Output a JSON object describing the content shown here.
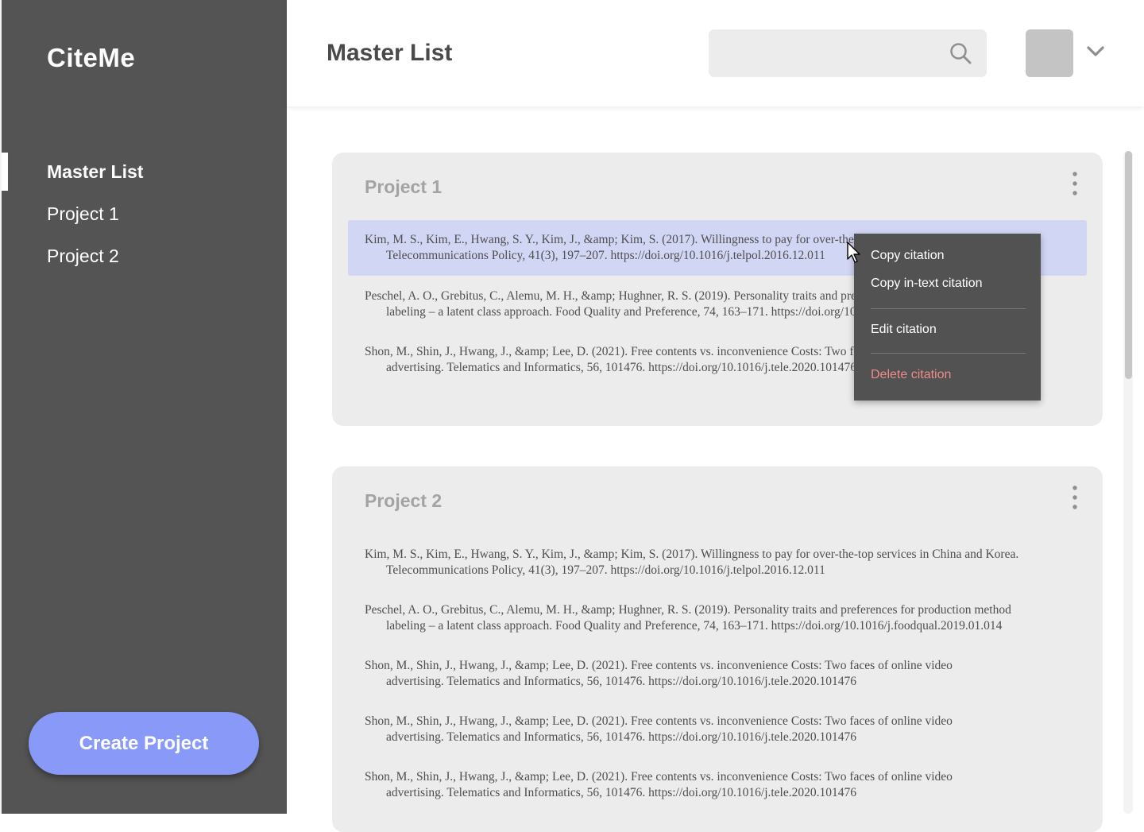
{
  "app": {
    "name": "CiteMe"
  },
  "sidebar": {
    "items": [
      {
        "label": "Master List",
        "active": true
      },
      {
        "label": "Project 1",
        "active": false
      },
      {
        "label": "Project 2",
        "active": false
      }
    ],
    "create_button": "Create Project"
  },
  "header": {
    "title": "Master List",
    "search": {
      "placeholder": "",
      "icon": "search-icon"
    },
    "avatar_icon": "avatar",
    "menu_icon": "chevron-down-icon"
  },
  "projects": [
    {
      "title": "Project 1",
      "citations": [
        {
          "line1": "Kim, M. S., Kim, E., Hwang, S. Y., Kim, J., &amp; Kim, S. (2017). Willingness to pay for over-the-top services in China and Korea.",
          "line2": "Telecommunications Policy, 41(3), 197–207. https://doi.org/10.1016/j.telpol.2016.12.011",
          "highlighted": true
        },
        {
          "line1": "Peschel, A. O., Grebitus, C., Alemu, M. H., &amp; Hughner, R. S. (2019). Personality traits and preferences for production method",
          "line2": "labeling – a latent class approach. Food Quality and Preference, 74, 163–171. https://doi.org/10.1016/j.foodqual.2019.01.014",
          "highlighted": false
        },
        {
          "line1": "Shon, M., Shin, J., Hwang, J., &amp; Lee, D. (2021). Free contents vs. inconvenience Costs: Two faces of online video",
          "line2": "advertising. Telematics and Informatics, 56, 101476. https://doi.org/10.1016/j.tele.2020.101476",
          "highlighted": false
        }
      ]
    },
    {
      "title": "Project 2",
      "citations": [
        {
          "line1": "Kim, M. S., Kim, E., Hwang, S. Y., Kim, J., &amp; Kim, S. (2017). Willingness to pay for over-the-top services in China and Korea.",
          "line2": "Telecommunications Policy, 41(3), 197–207. https://doi.org/10.1016/j.telpol.2016.12.011"
        },
        {
          "line1": "Peschel, A. O., Grebitus, C., Alemu, M. H., &amp; Hughner, R. S. (2019). Personality traits and preferences for production method",
          "line2": "labeling – a latent class approach. Food Quality and Preference, 74, 163–171. https://doi.org/10.1016/j.foodqual.2019.01.014"
        },
        {
          "line1": "Shon, M., Shin, J., Hwang, J., &amp; Lee, D. (2021). Free contents vs. inconvenience Costs: Two faces of online video",
          "line2": "advertising. Telematics and Informatics, 56, 101476. https://doi.org/10.1016/j.tele.2020.101476"
        },
        {
          "line1": "Shon, M., Shin, J., Hwang, J., &amp; Lee, D. (2021). Free contents vs. inconvenience Costs: Two faces of online video",
          "line2": "advertising. Telematics and Informatics, 56, 101476. https://doi.org/10.1016/j.tele.2020.101476"
        },
        {
          "line1": "Shon, M., Shin, J., Hwang, J., &amp; Lee, D. (2021). Free contents vs. inconvenience Costs: Two faces of online video",
          "line2": "advertising. Telematics and Informatics, 56, 101476. https://doi.org/10.1016/j.tele.2020.101476"
        }
      ]
    }
  ],
  "context_menu": {
    "items": [
      {
        "label": "Copy citation"
      },
      {
        "label": "Copy in-text citation"
      },
      {
        "label": "Edit citation"
      },
      {
        "label": "Delete citation"
      }
    ]
  },
  "colors": {
    "sidebar_bg": "#545454",
    "accent": "#8899f7",
    "card_bg": "#ececec",
    "highlight": "#d2d6f5",
    "menu_bg": "#525252",
    "danger": "#ef8a8a"
  }
}
